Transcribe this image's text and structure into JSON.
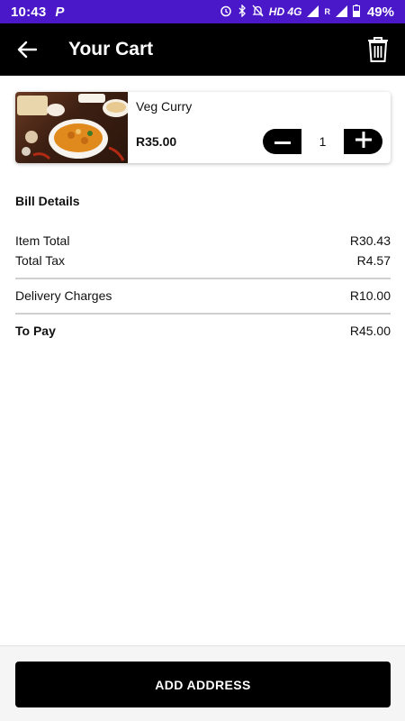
{
  "status_bar": {
    "time": "10:43",
    "app_icon": "P",
    "network": "HD 4G",
    "roaming": "R",
    "battery_percent": "49%"
  },
  "toolbar": {
    "title": "Your Cart",
    "back_icon": "arrow-left-icon",
    "delete_icon": "trash-icon"
  },
  "cart_item": {
    "name": "Veg Curry",
    "price": "R35.00",
    "quantity": "1",
    "minus_icon": "minus-icon",
    "plus_icon": "plus-icon"
  },
  "bill": {
    "title": "Bill Details",
    "item_total_label": "Item Total",
    "item_total_value": "R30.43",
    "tax_label": "Total Tax",
    "tax_value": "R4.57",
    "delivery_label": "Delivery Charges",
    "delivery_value": "R10.00",
    "to_pay_label": "To Pay",
    "to_pay_value": "R45.00"
  },
  "footer": {
    "button_label": "ADD ADDRESS"
  },
  "colors": {
    "status_bar": "#4b18c9",
    "toolbar": "#000000",
    "button": "#000000"
  }
}
